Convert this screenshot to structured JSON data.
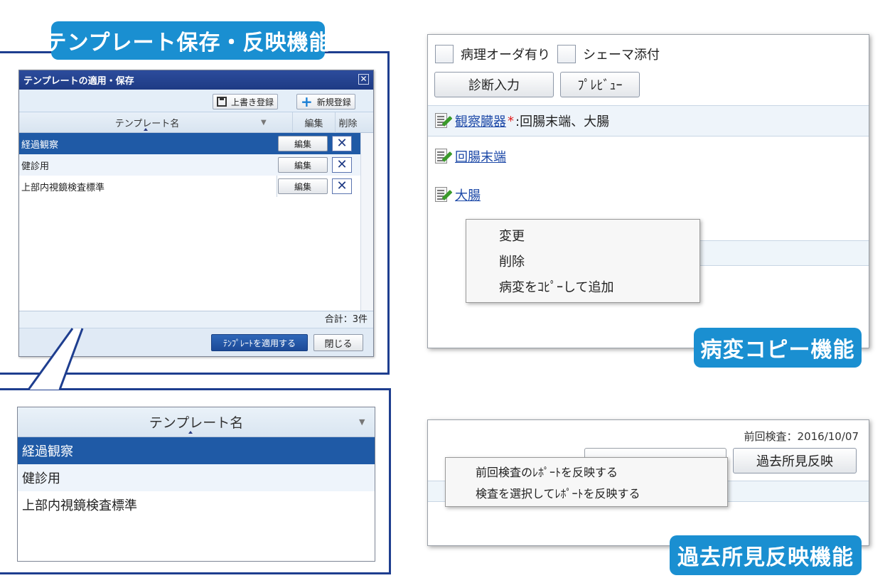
{
  "labels": {
    "template_feature": "テンプレート保存・反映機能",
    "lesion_copy_feature": "病変コピー機能",
    "past_findings_feature": "過去所見反映機能"
  },
  "template_window": {
    "title": "テンプレートの適用・保存",
    "overwrite_label": "上書き登録",
    "new_label": "新規登録",
    "columns": {
      "name": "テンプレート名",
      "edit": "編集",
      "delete": "削除"
    },
    "rows": [
      {
        "name": "経過観察",
        "edit_label": "編集"
      },
      {
        "name": "健診用",
        "edit_label": "編集"
      },
      {
        "name": "上部内視鏡検査標準",
        "edit_label": "編集"
      }
    ],
    "total": "合計：3件",
    "apply_label": "ﾃﾝﾌﾟﾚｰﾄを適用する",
    "close_label": "閉じる"
  },
  "zoom": {
    "header": "テンプレート名",
    "rows": [
      "経過観察",
      "健診用",
      "上部内視鏡検査標準"
    ]
  },
  "lesion_panel": {
    "checkbox1": "病理オーダ有り",
    "checkbox2": "シェーマ添付",
    "diagnosis_btn": "診断入力",
    "preview_btn": "ﾌﾟﾚﾋﾞｭｰ",
    "organ_link": "観察臓器",
    "organ_required": "*",
    "organ_value": ":回腸末端、大腸",
    "lesions": [
      "回腸末端",
      "大腸"
    ],
    "menu": [
      "変更",
      "削除",
      "病変をｺﾋﾟｰして追加"
    ]
  },
  "past_panel": {
    "prev_exam": "前回検査：2016/10/07",
    "reflect_btn": "過去所見反映",
    "menu": [
      "前回検査のﾚﾎﾟｰﾄを反映する",
      "検査を選択してﾚﾎﾟｰﾄを反映する"
    ]
  },
  "colors": {
    "accent": "#1a8fd1",
    "frame": "#1e3e8f",
    "selected_row": "#1f5aa6",
    "link": "#1e4aa8",
    "required": "#e22020"
  }
}
